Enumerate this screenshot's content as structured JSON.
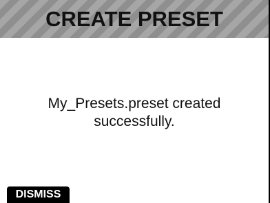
{
  "dialog": {
    "title": "CREATE PRESET",
    "message_line1": "My_Presets.preset created",
    "message_line2": "successfully.",
    "dismiss_label": "DISMISS"
  },
  "colors": {
    "title_bar": "#9a9a9a",
    "title_stripe_light": "#a6a6a6",
    "title_stripe_dark": "#8f8f8f",
    "background": "#ffffff",
    "button": "#000000",
    "button_text": "#ffffff"
  }
}
